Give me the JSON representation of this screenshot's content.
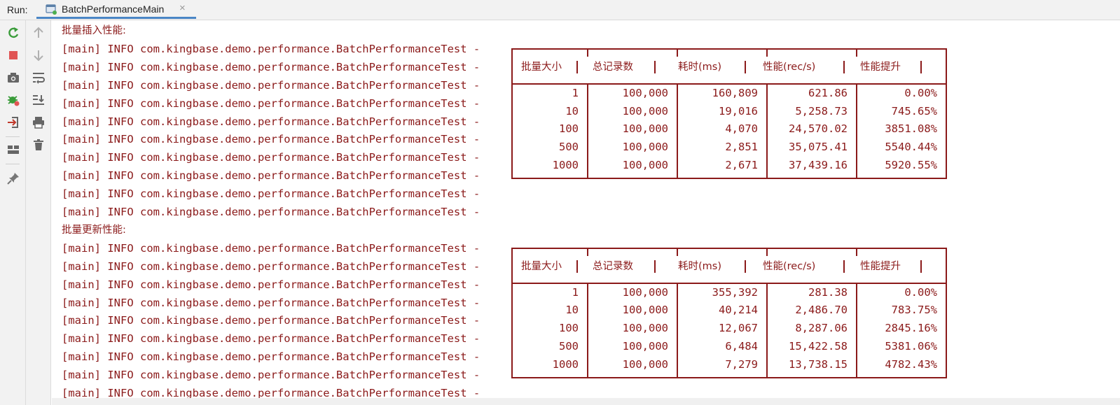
{
  "header": {
    "run_label": "Run:",
    "tab_title": "BatchPerformanceMain",
    "close_glyph": "×"
  },
  "toolbar_left": [
    {
      "name": "rerun-icon",
      "color": "#3a9c3a"
    },
    {
      "name": "stop-icon",
      "color": "#e05555"
    },
    {
      "name": "camera-icon",
      "color": "#666666"
    },
    {
      "name": "debug-settings-icon",
      "color": "#3a9c3a"
    },
    {
      "name": "login-icon",
      "color": "#c0392b"
    },
    {
      "name": "layout-icon",
      "color": "#666666"
    },
    {
      "name": "pin-icon",
      "color": "#777777"
    }
  ],
  "toolbar_right": [
    {
      "name": "up-arrow-icon"
    },
    {
      "name": "down-arrow-icon"
    },
    {
      "name": "soft-wrap-icon"
    },
    {
      "name": "scroll-to-end-icon"
    },
    {
      "name": "print-icon"
    },
    {
      "name": "trash-icon"
    }
  ],
  "console": {
    "log_prefix": "[main] INFO com.kingbase.demo.performance.BatchPerformanceTest -",
    "sections": [
      {
        "title": "批量插入性能:",
        "headers": [
          "批量大小",
          "总记录数",
          "耗时(ms)",
          "性能(rec/s)",
          "性能提升"
        ],
        "rows": [
          [
            "1",
            "100,000",
            "160,809",
            "621.86",
            "0.00%"
          ],
          [
            "10",
            "100,000",
            "19,016",
            "5,258.73",
            "745.65%"
          ],
          [
            "100",
            "100,000",
            "4,070",
            "24,570.02",
            "3851.08%"
          ],
          [
            "500",
            "100,000",
            "2,851",
            "35,075.41",
            "5540.44%"
          ],
          [
            "1000",
            "100,000",
            "2,671",
            "37,439.16",
            "5920.55%"
          ]
        ]
      },
      {
        "title": "批量更新性能:",
        "headers": [
          "批量大小",
          "总记录数",
          "耗时(ms)",
          "性能(rec/s)",
          "性能提升"
        ],
        "rows": [
          [
            "1",
            "100,000",
            "355,392",
            "281.38",
            "0.00%"
          ],
          [
            "10",
            "100,000",
            "40,214",
            "2,486.70",
            "783.75%"
          ],
          [
            "100",
            "100,000",
            "12,067",
            "8,287.06",
            "2845.16%"
          ],
          [
            "500",
            "100,000",
            "6,484",
            "15,422.58",
            "5381.06%"
          ],
          [
            "1000",
            "100,000",
            "7,279",
            "13,738.15",
            "4782.43%"
          ]
        ]
      }
    ]
  },
  "colors": {
    "log_text": "#8b1a1a",
    "tab_underline": "#4a86c5",
    "toolbar_bg": "#f2f2f2"
  }
}
